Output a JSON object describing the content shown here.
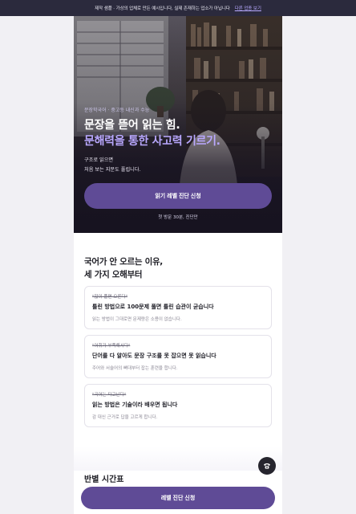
{
  "notice": {
    "text": "제작 샘플 · 가상의 업체로 만든 예시입니다, 실제 존재하는 업소가 아닙니다",
    "link": "다른 업종 보기"
  },
  "hero": {
    "eyebrow": "문장학국어 · 중고등 내신과 수능",
    "headline_line1": "문장을 뜯어 읽는 힘.",
    "headline_line2": "문해력을 통한 사고력 기르기.",
    "sub_line1": "구조로 읽으면",
    "sub_line2": "처음 보는 지문도 풀립니다.",
    "cta_label": "읽기 레벨 진단 신청",
    "cta_note": "첫 방문 30분, 진단만"
  },
  "section": {
    "title_line1": "국어가 안 오르는 이유,",
    "title_line2": "세 가지 오해부터"
  },
  "cards": [
    {
      "tag": "\"많이 풀면 오른다\"",
      "title": "틀린 방법으로 100문제 풀면 틀린 습관이 굳습니다",
      "desc": "읽는 방법이 그대로면 문제량은 소용이 없습니다."
    },
    {
      "tag": "\"어휘가 부족해서다\"",
      "title": "단어를 다 알아도 문장 구조를 못 잡으면 못 읽습니다",
      "desc": "주어와 서술어의 뼈대부터 잡는 훈련을 합니다."
    },
    {
      "tag": "\"국어는 타고난다\"",
      "title": "읽는 방법은 기술이라 배우면 됩니다",
      "desc": "감 대신 근거로 답을 고르게 합니다."
    }
  ],
  "next_section_title": "반별 시간표",
  "bottom_cta_label": "레벨 진단 신청",
  "colors": {
    "accent": "#5f4b96",
    "accent_light": "#b9a8ff",
    "notice_bg": "#2b2a3d",
    "fab_bg": "#26252e"
  },
  "icons": {
    "chat_fab": "phone-icon"
  }
}
